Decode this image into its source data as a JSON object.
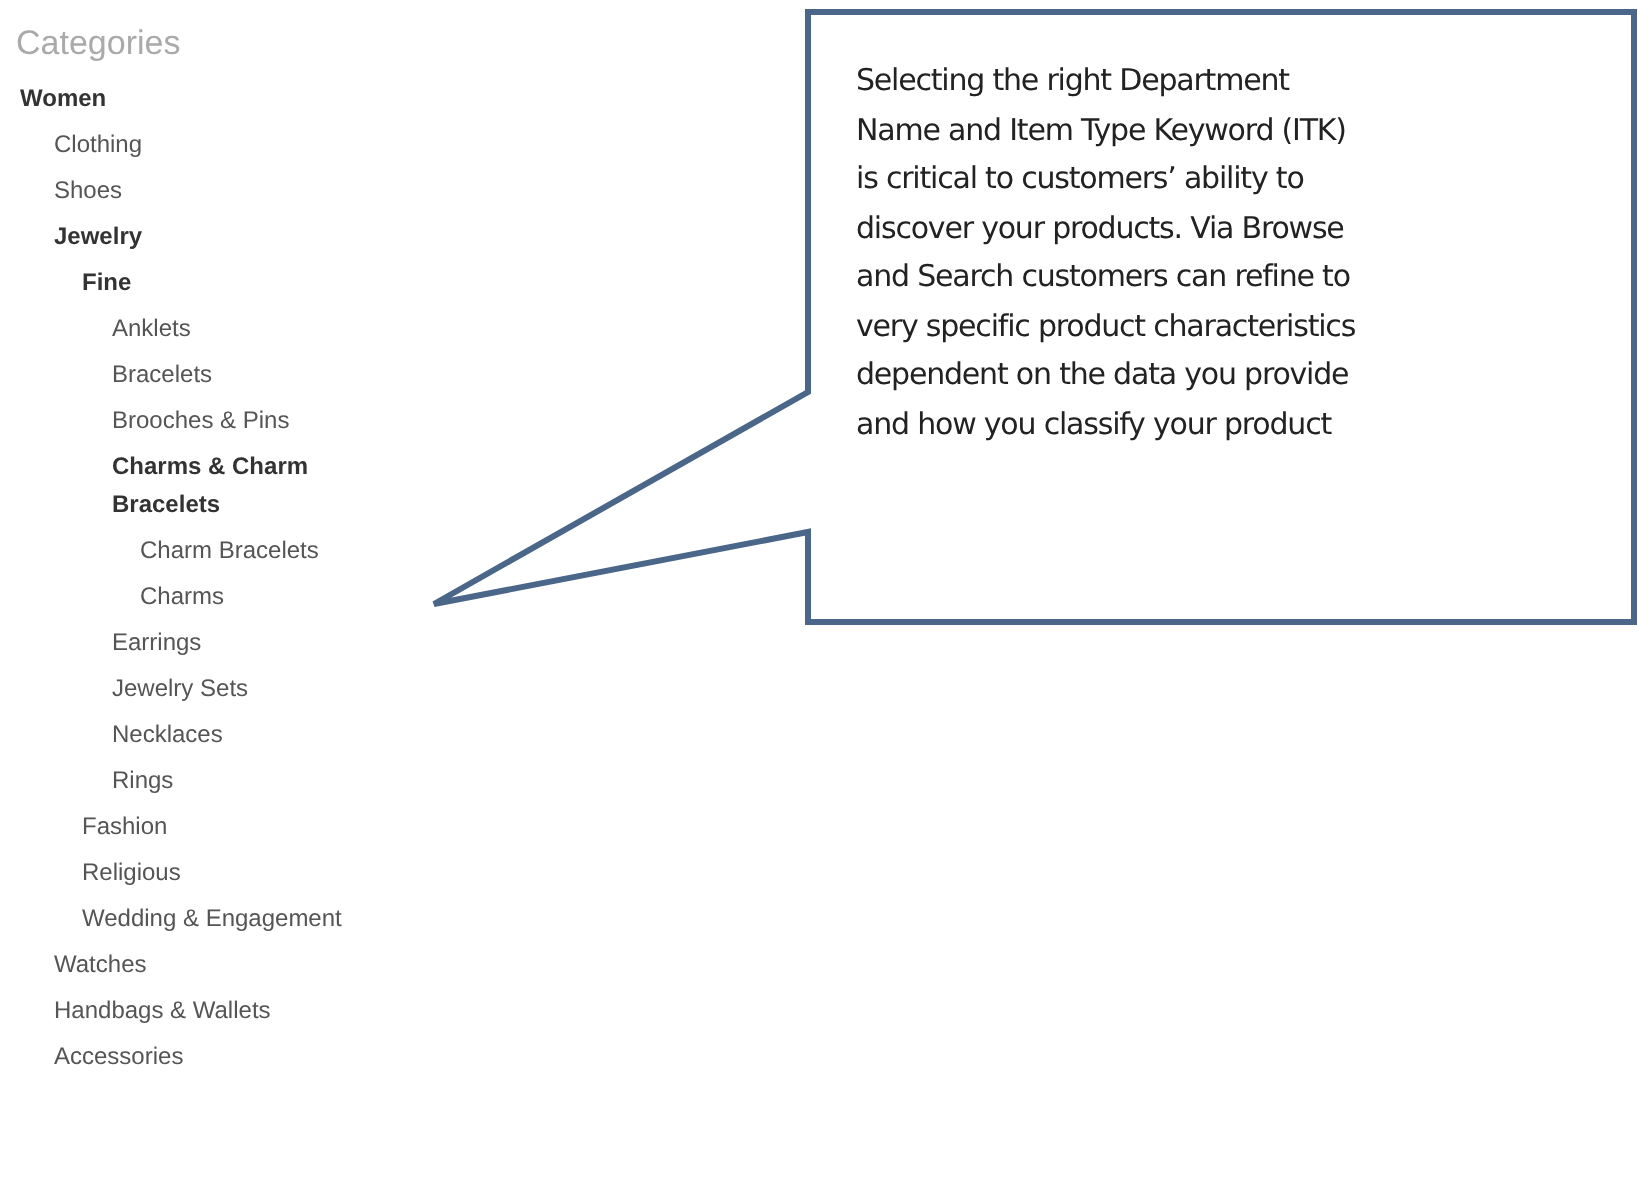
{
  "heading": "Categories",
  "tree": [
    {
      "label": "Women",
      "children": [
        {
          "label": "Clothing"
        },
        {
          "label": "Shoes"
        },
        {
          "label": "Jewelry",
          "children": [
            {
              "label": "Fine",
              "children": [
                {
                  "label": "Anklets"
                },
                {
                  "label": "Bracelets"
                },
                {
                  "label": "Brooches & Pins"
                },
                {
                  "label": "Charms & Charm Bracelets",
                  "children": [
                    {
                      "label": "Charm Bracelets"
                    },
                    {
                      "label": "Charms"
                    }
                  ]
                },
                {
                  "label": "Earrings"
                },
                {
                  "label": "Jewelry Sets"
                },
                {
                  "label": "Necklaces"
                },
                {
                  "label": "Rings"
                }
              ]
            },
            {
              "label": "Fashion"
            },
            {
              "label": "Religious"
            },
            {
              "label": "Wedding & Engagement"
            }
          ]
        },
        {
          "label": "Watches"
        },
        {
          "label": "Handbags & Wallets"
        },
        {
          "label": "Accessories"
        }
      ]
    }
  ],
  "callout": {
    "lines": [
      "Selecting the right Department",
      "Name and Item Type Keyword (ITK)",
      "is critical to customers’ ability to",
      "discover your products. Via Browse",
      "and Search customers can refine to",
      "very specific product characteristics",
      "dependent on the data you provide",
      "and how you classify your product"
    ]
  }
}
